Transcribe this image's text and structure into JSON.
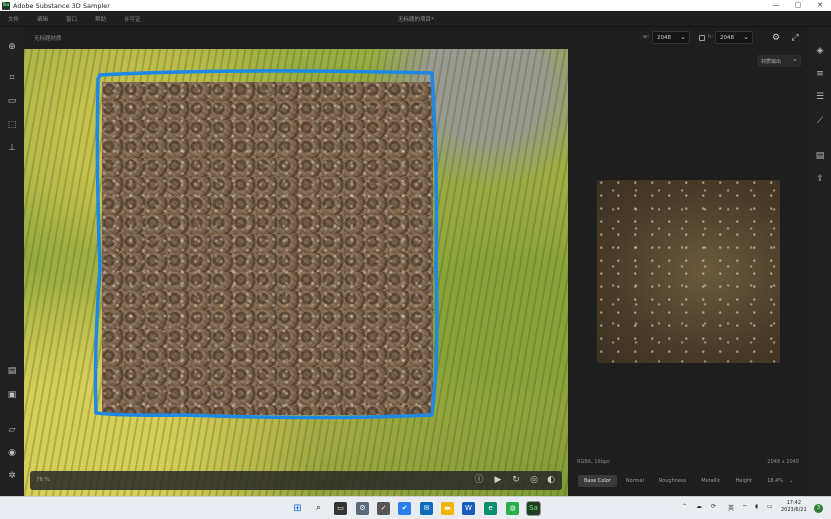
{
  "window": {
    "title": "Adobe Substance 3D Sampler",
    "logo_text": "Sa",
    "controls": [
      "—",
      "▢",
      "✕"
    ]
  },
  "menu": {
    "items": [
      "文件",
      "编辑",
      "窗口",
      "帮助",
      "许可证"
    ],
    "project_title": "无标题的项目*"
  },
  "topbar": {
    "doc_name": "无标题材质",
    "width_label": "w:",
    "width_value": "2048",
    "height_label": "h:",
    "height_value": "2048"
  },
  "viewport": {
    "zoom": "76 %",
    "outline_color": "#1e88e5"
  },
  "preview": {
    "output_select": "材质输出",
    "format": "RGBA, 16bpc",
    "resolution": "2048 x 2048",
    "channels": [
      "Base Color",
      "Normal",
      "Roughness",
      "Metallic",
      "Height"
    ],
    "active_channel": "Base Color",
    "zoom": "18.4%"
  },
  "taskbar": {
    "time": "17:42",
    "date": "2023/6/21",
    "ime": "英",
    "notification_count": "3",
    "active_app": "Sa"
  }
}
